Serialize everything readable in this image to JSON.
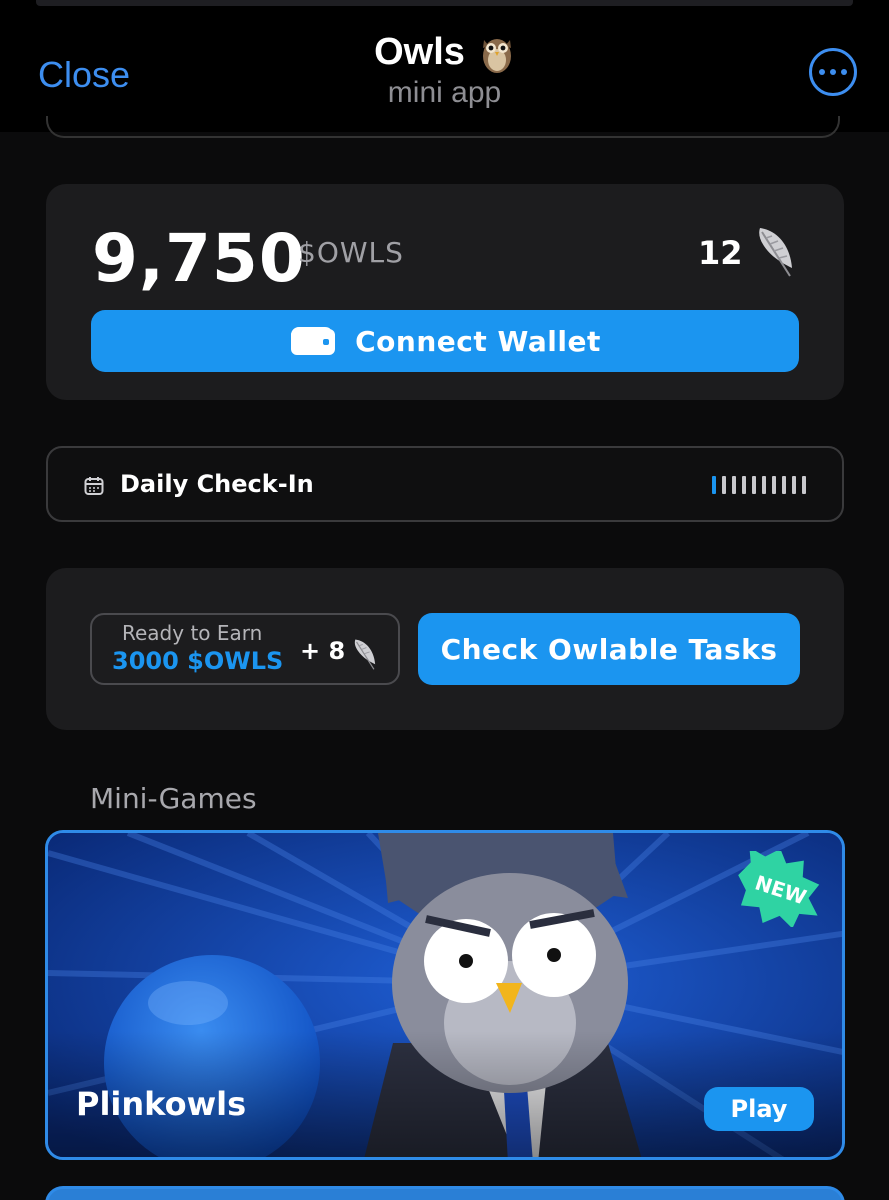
{
  "header": {
    "close_label": "Close",
    "title": "Owls",
    "subtitle": "mini app",
    "title_icon": "owl-emoji-icon",
    "more_icon": "more-ellipsis-icon"
  },
  "balance": {
    "amount": "9,750",
    "unit": "$OWLS",
    "feather_count": "12",
    "feather_icon": "feather-icon",
    "connect_label": "Connect Wallet",
    "connect_icon": "wallet-icon"
  },
  "checkin": {
    "label": "Daily Check-In",
    "icon": "calendar-icon",
    "days_total": 10,
    "days_completed": 1
  },
  "tasks": {
    "earn_caption": "Ready to Earn",
    "earn_value": "3000 $OWLS",
    "bonus": "+ 8",
    "button_label": "Check Owlable Tasks"
  },
  "minigames": {
    "section_title": "Mini-Games",
    "games": [
      {
        "title": "Plinkowls",
        "badge": "NEW",
        "play_label": "Play"
      }
    ]
  },
  "colors": {
    "accent": "#1b95f0",
    "ios_blue": "#3d8ef0",
    "card_bg": "#1c1c1e",
    "background": "#0b0b0c"
  }
}
